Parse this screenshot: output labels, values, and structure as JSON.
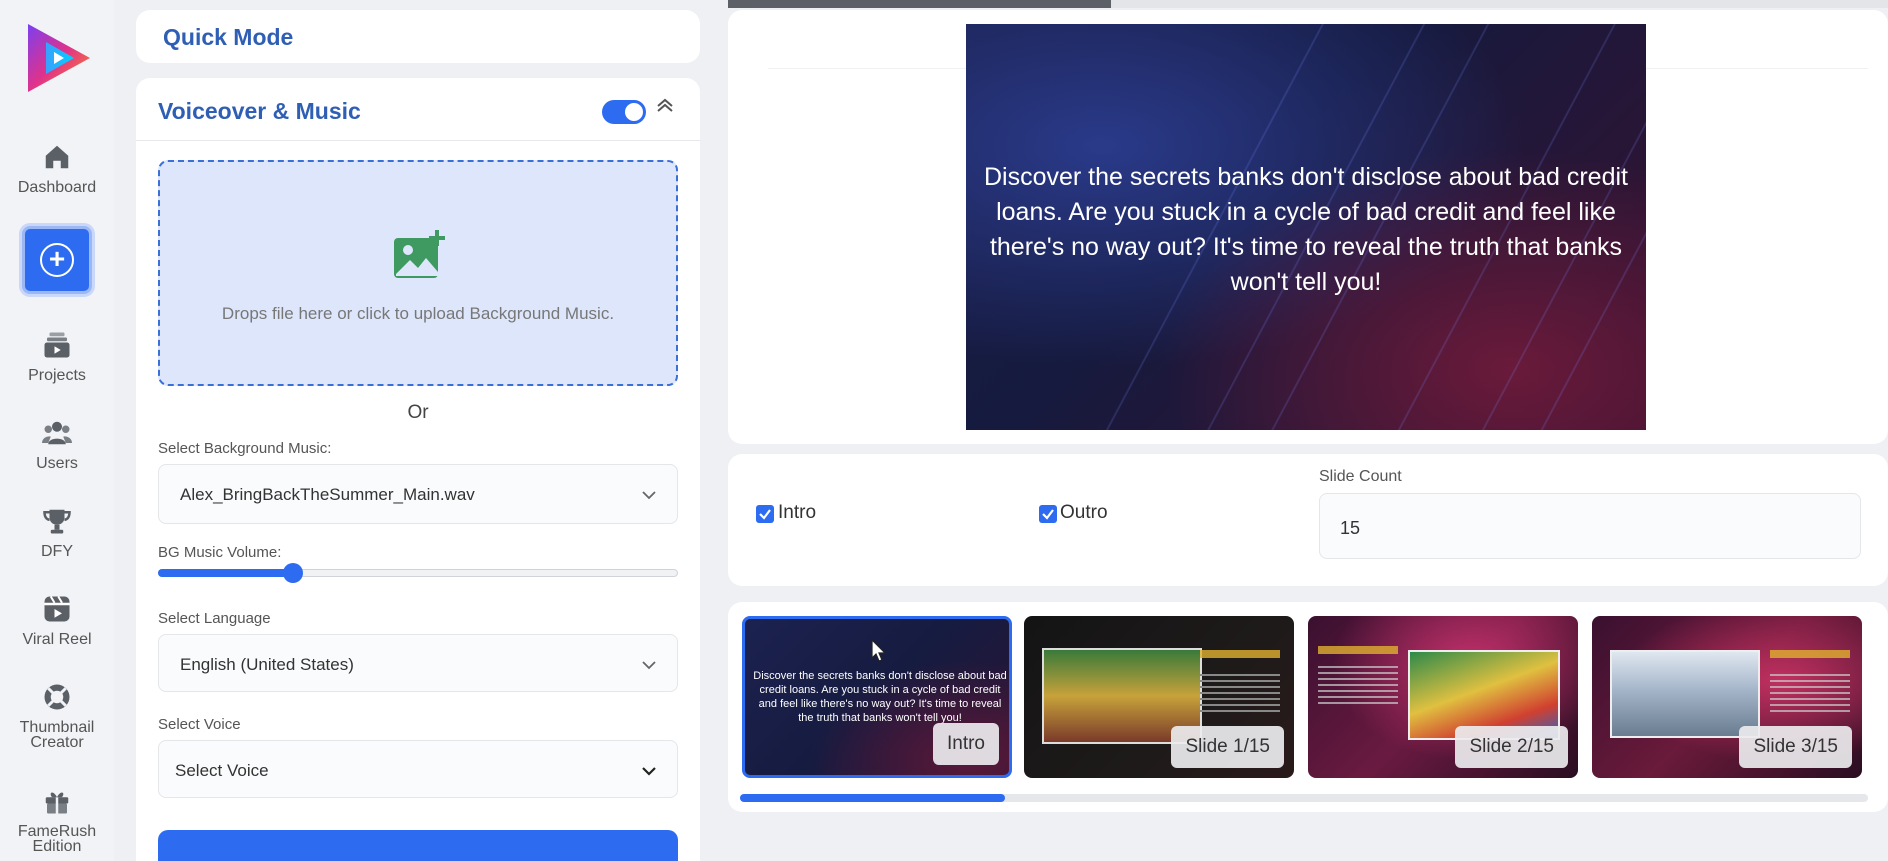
{
  "sidebar": {
    "items": [
      {
        "label": "Dashboard",
        "icon": "home-icon"
      },
      {
        "label": "Projects",
        "icon": "projects-icon"
      },
      {
        "label": "Users",
        "icon": "users-icon"
      },
      {
        "label": "DFY",
        "icon": "trophy-icon"
      },
      {
        "label": "Viral Reel",
        "icon": "reel-icon"
      },
      {
        "label": "Thumbnail Creator",
        "icon": "lifebuoy-icon"
      },
      {
        "label": "FameRush Edition",
        "icon": "gift-icon"
      }
    ],
    "create_icon": "plus-icon"
  },
  "quick_mode": {
    "title": "Quick Mode"
  },
  "voiceover": {
    "title": "Voiceover & Music",
    "toggle_on": true,
    "dropzone_text": "Drops file here or click to upload Background Music.",
    "or_text": "Or",
    "bg_music_label": "Select Background Music:",
    "bg_music_value": "Alex_BringBackTheSummer_Main.wav",
    "volume_label": "BG Music Volume:",
    "volume_fraction": 0.26,
    "language_label": "Select Language",
    "language_value": "English (United States)",
    "voice_label": "Select Voice",
    "voice_value": "Select Voice"
  },
  "preview": {
    "progress_fraction": 0.33,
    "caption": "Discover the secrets banks don't disclose about bad credit loans. Are you stuck in a cycle of bad credit and feel like there's no way out? It's time to reveal the truth that banks won't tell you!"
  },
  "options": {
    "intro_label": "Intro",
    "intro_checked": true,
    "outro_label": "Outro",
    "outro_checked": true,
    "slide_count_label": "Slide Count",
    "slide_count_value": "15"
  },
  "slides": {
    "scroll_fraction": 0.235,
    "items": [
      {
        "label": "Intro",
        "text": "Discover the secrets banks don't disclose about bad credit loans. Are you stuck in a cycle of bad credit and feel like there's no way out? It's time to reveal the truth that banks won't tell you!",
        "active": true
      },
      {
        "label": "Slide 1/15",
        "active": false
      },
      {
        "label": "Slide 2/15",
        "active": false
      },
      {
        "label": "Slide 3/15",
        "active": false
      }
    ]
  },
  "colors": {
    "accent": "#2d6cf0",
    "title_blue": "#2f5fb5",
    "dropzone_bg": "#dde6fb"
  }
}
